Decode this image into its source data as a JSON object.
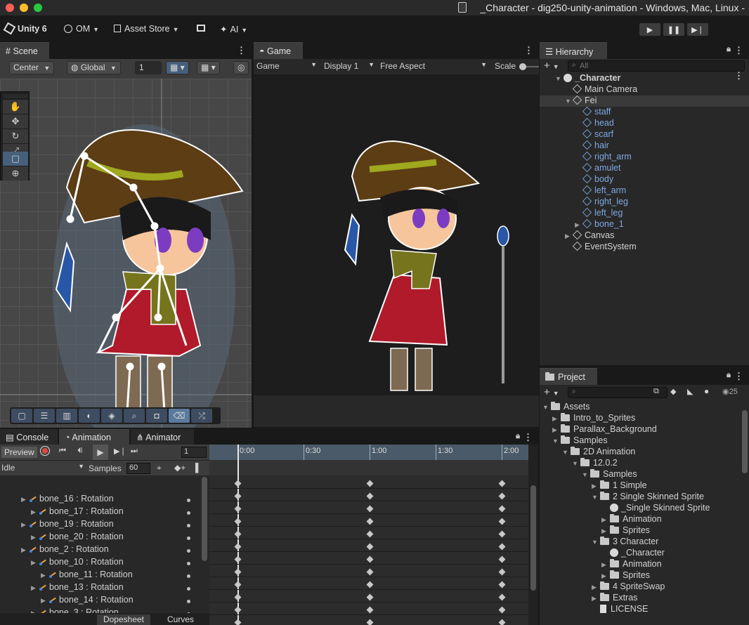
{
  "window": {
    "title": "_Character - dig250-unity-animation - Windows, Mac, Linux -",
    "traffic_colors": [
      "#fe5f57",
      "#febc2e",
      "#28c840"
    ]
  },
  "toolbar": {
    "unity_label": "Unity 6",
    "account_label": "OM",
    "asset_store_label": "Asset Store",
    "ai_label": "AI"
  },
  "scene": {
    "tab_label": "Scene",
    "pivot_label": "Center",
    "space_label": "Global",
    "snap_value": "1"
  },
  "game": {
    "tab_label": "Game",
    "mode_label": "Game",
    "display_label": "Display 1",
    "aspect_label": "Free Aspect",
    "scale_label": "Scale"
  },
  "hierarchy": {
    "tab_label": "Hierarchy",
    "search_placeholder": "All",
    "items": [
      {
        "label": "_Character",
        "depth": 0,
        "icon": "unity-icon",
        "expanded": true
      },
      {
        "label": "Main Camera",
        "depth": 1,
        "icon": "cube-icon"
      },
      {
        "label": "Fei",
        "depth": 1,
        "icon": "cube-icon",
        "expanded": true,
        "selected": true
      },
      {
        "label": "staff",
        "depth": 2,
        "icon": "cube-icon",
        "blue": true
      },
      {
        "label": "head",
        "depth": 2,
        "icon": "cube-icon",
        "blue": true
      },
      {
        "label": "scarf",
        "depth": 2,
        "icon": "cube-icon",
        "blue": true
      },
      {
        "label": "hair",
        "depth": 2,
        "icon": "cube-icon",
        "blue": true
      },
      {
        "label": "right_arm",
        "depth": 2,
        "icon": "cube-icon",
        "blue": true
      },
      {
        "label": "amulet",
        "depth": 2,
        "icon": "cube-icon",
        "blue": true
      },
      {
        "label": "body",
        "depth": 2,
        "icon": "cube-icon",
        "blue": true
      },
      {
        "label": "left_arm",
        "depth": 2,
        "icon": "cube-icon",
        "blue": true
      },
      {
        "label": "right_leg",
        "depth": 2,
        "icon": "cube-icon",
        "blue": true
      },
      {
        "label": "left_leg",
        "depth": 2,
        "icon": "cube-icon",
        "blue": true
      },
      {
        "label": "bone_1",
        "depth": 2,
        "icon": "cube-icon",
        "blue": true,
        "collapsed": true
      },
      {
        "label": "Canvas",
        "depth": 1,
        "icon": "cube-icon",
        "collapsed": true
      },
      {
        "label": "EventSystem",
        "depth": 1,
        "icon": "cube-icon"
      }
    ]
  },
  "project": {
    "tab_label": "Project",
    "hidden_count": "25",
    "items": [
      {
        "label": "Assets",
        "depth": 0,
        "expanded": true
      },
      {
        "label": "Intro_to_Sprites",
        "depth": 1
      },
      {
        "label": "Parallax_Background",
        "depth": 1
      },
      {
        "label": "Samples",
        "depth": 1,
        "expanded": true
      },
      {
        "label": "2D Animation",
        "depth": 2,
        "expanded": true
      },
      {
        "label": "12.0.2",
        "depth": 3,
        "expanded": true
      },
      {
        "label": "Samples",
        "depth": 4,
        "expanded": true
      },
      {
        "label": "1 Simple",
        "depth": 5
      },
      {
        "label": "2 Single Skinned Sprite",
        "depth": 5,
        "expanded": true
      },
      {
        "label": "_Single Skinned Sprite",
        "depth": 6,
        "icon": "unity-icon"
      },
      {
        "label": "Animation",
        "depth": 6
      },
      {
        "label": "Sprites",
        "depth": 6
      },
      {
        "label": "3 Character",
        "depth": 5,
        "expanded": true
      },
      {
        "label": "_Character",
        "depth": 6,
        "icon": "unity-icon"
      },
      {
        "label": "Animation",
        "depth": 6
      },
      {
        "label": "Sprites",
        "depth": 6
      },
      {
        "label": "4 SpriteSwap",
        "depth": 5
      },
      {
        "label": "Extras",
        "depth": 5
      },
      {
        "label": "LICENSE",
        "depth": 5,
        "icon": "file-icon"
      }
    ]
  },
  "animation": {
    "tabs": [
      "Console",
      "Animation",
      "Animator"
    ],
    "preview_label": "Preview",
    "frame_value": "1",
    "clip_label": "Idle",
    "samples_label": "Samples",
    "samples_value": "60",
    "time_ticks": [
      "0:00",
      "0:30",
      "1:00",
      "1:30",
      "2:00"
    ],
    "properties": [
      {
        "label": "bone_16 : Rotation",
        "indent": 0,
        "arrow": true
      },
      {
        "label": "bone_17 : Rotation",
        "indent": 1,
        "arrow": true
      },
      {
        "label": "bone_19 : Rotation",
        "indent": 0,
        "arrow": true
      },
      {
        "label": "bone_20 : Rotation",
        "indent": 1,
        "arrow": true
      },
      {
        "label": "bone_2 : Rotation",
        "indent": 0,
        "arrow": true
      },
      {
        "label": "bone_10 : Rotation",
        "indent": 1,
        "arrow": true
      },
      {
        "label": "bone_11 : Rotation",
        "indent": 2,
        "arrow": true
      },
      {
        "label": "bone_13 : Rotation",
        "indent": 1,
        "arrow": true
      },
      {
        "label": "bone_14 : Rotation",
        "indent": 2,
        "arrow": true
      },
      {
        "label": "bone_3 : Rotation",
        "indent": 1,
        "arrow": true
      }
    ],
    "footer_tabs": [
      "Dopesheet",
      "Curves"
    ]
  }
}
